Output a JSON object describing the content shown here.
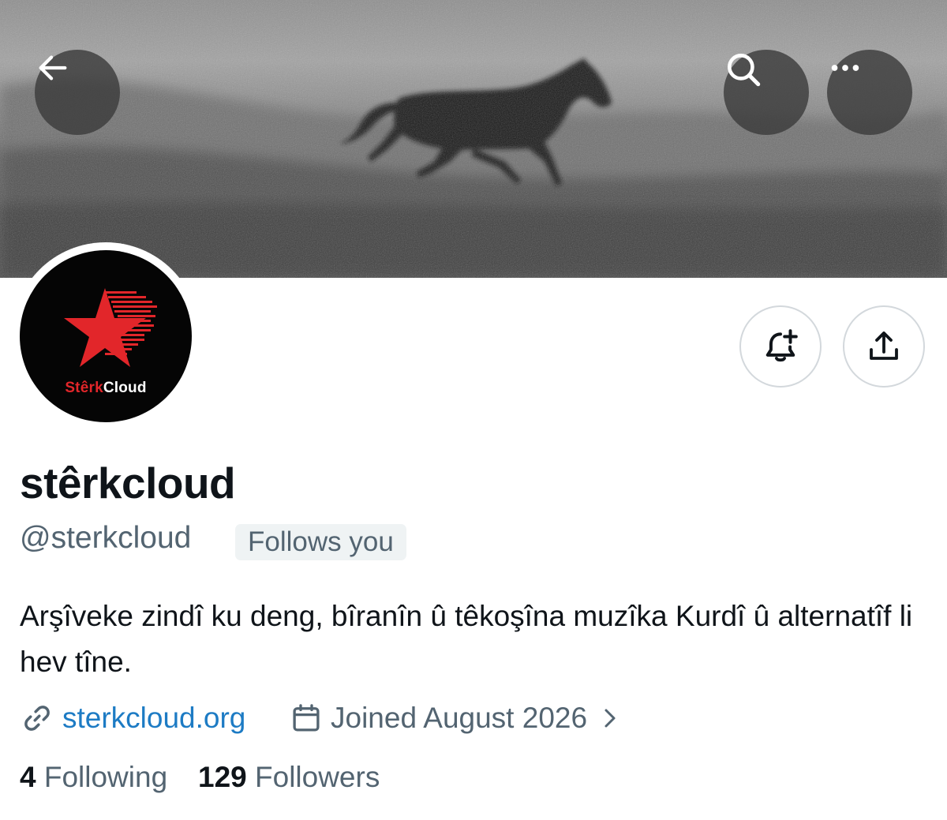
{
  "header": {
    "back_icon": "arrow-left-icon",
    "search_icon": "search-icon",
    "more_icon": "more-horizontal-icon"
  },
  "profile": {
    "avatar_logo_text_red": "Stêrk",
    "avatar_logo_text_white": "Cloud",
    "display_name": "stêrkcloud",
    "handle": "@sterkcloud",
    "follows_badge": "Follows you",
    "bio": "Arşîveke zindî ku deng, bîranîn û têkoşîna muzîka Kurdî û alternatîf li hev tîne.",
    "website": "sterkcloud.org",
    "joined": "Joined August 2026"
  },
  "actions": {
    "notify_icon": "bell-plus-icon",
    "share_icon": "share-upload-icon"
  },
  "stats": {
    "following_count": "4",
    "following_label": "Following",
    "followers_count": "129",
    "followers_label": "Followers"
  },
  "colors": {
    "link": "#1d7bc4",
    "secondary_text": "#536471",
    "primary_text": "#0f1419",
    "logo_red": "#e2262a"
  }
}
